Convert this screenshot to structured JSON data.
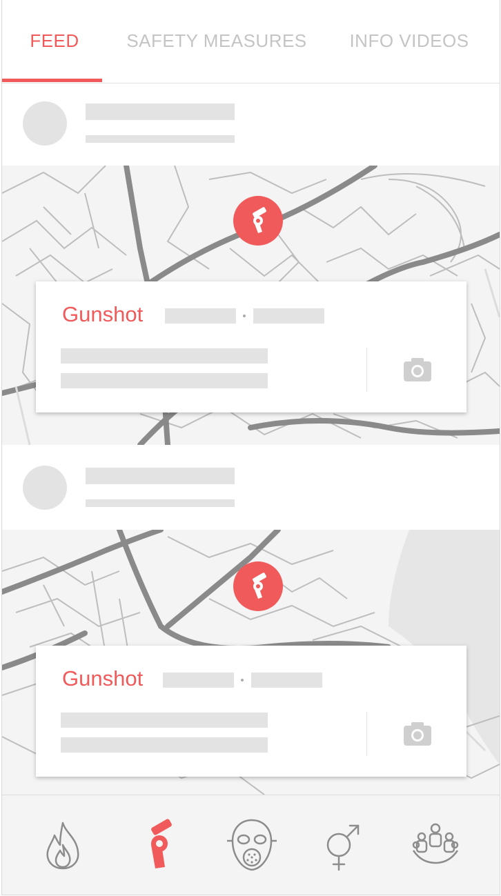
{
  "tabs": [
    {
      "label": "FEED",
      "active": true
    },
    {
      "label": "SAFETY MEASURES",
      "active": false
    },
    {
      "label": "INFO VIDEOS",
      "active": false
    }
  ],
  "feed": [
    {
      "incident_type": "Gunshot",
      "pin_icon": "revolver-icon",
      "attachment_icon": "camera-icon"
    },
    {
      "incident_type": "Gunshot",
      "pin_icon": "revolver-icon",
      "attachment_icon": "camera-icon"
    }
  ],
  "bottom_nav": [
    {
      "icon": "fire-icon",
      "active": false
    },
    {
      "icon": "revolver-icon",
      "active": true
    },
    {
      "icon": "gas-mask-icon",
      "active": false
    },
    {
      "icon": "gender-icon",
      "active": false
    },
    {
      "icon": "crowd-icon",
      "active": false
    }
  ],
  "colors": {
    "accent": "#f05a5a",
    "inactive": "#c4c4c4",
    "placeholder": "#e3e3e3",
    "map_road": "#8a8a8a"
  }
}
